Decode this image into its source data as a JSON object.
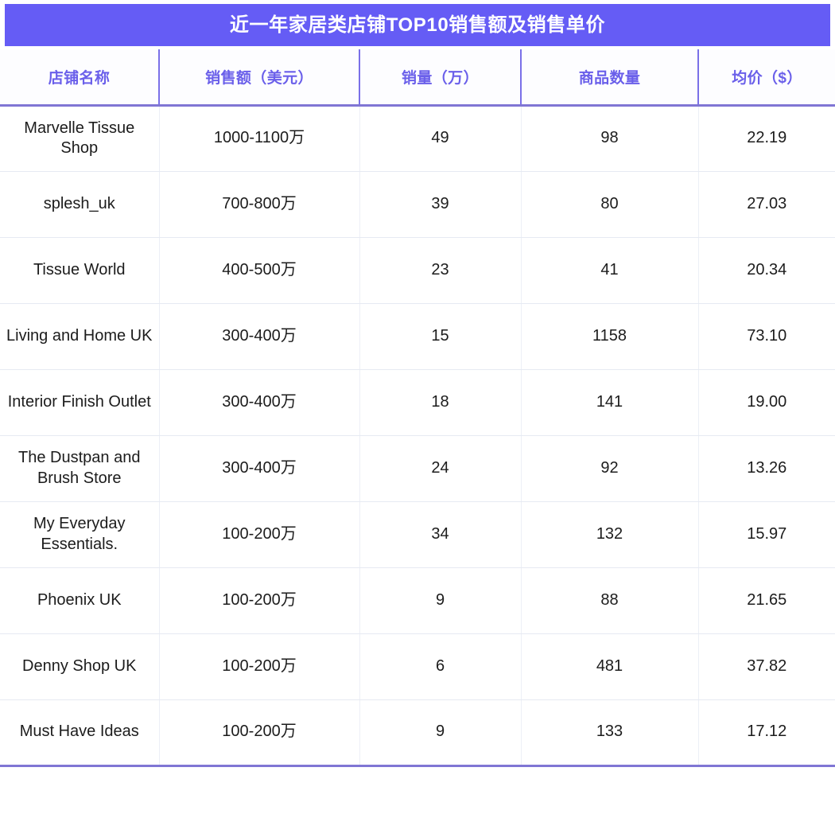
{
  "title": "近一年家居类店铺TOP10销售额及销售单价",
  "theme": {
    "banner_bg": "#655CF5",
    "banner_text": "#FFFFFF",
    "header_text": "#6A5FEA",
    "header_divider": "#7A70E8",
    "body_text": "#1C1C1C",
    "row_divider": "#E6EAF2"
  },
  "chart_data": {
    "type": "table",
    "title": "近一年家居类店铺TOP10销售额及销售单价",
    "columns": [
      "店铺名称",
      "销售额（美元）",
      "销量（万）",
      "商品数量",
      "均价（$）"
    ],
    "rows": [
      [
        "Marvelle Tissue Shop",
        "1000-1100万",
        "49",
        "98",
        "22.19"
      ],
      [
        "splesh_uk",
        "700-800万",
        "39",
        "80",
        "27.03"
      ],
      [
        "Tissue World",
        "400-500万",
        "23",
        "41",
        "20.34"
      ],
      [
        "Living and Home UK",
        "300-400万",
        "15",
        "1158",
        "73.10"
      ],
      [
        "Interior Finish Outlet",
        "300-400万",
        "18",
        "141",
        "19.00"
      ],
      [
        "The Dustpan and Brush Store",
        "300-400万",
        "24",
        "92",
        "13.26"
      ],
      [
        "My Everyday Essentials.",
        "100-200万",
        "34",
        "132",
        "15.97"
      ],
      [
        "Phoenix UK",
        "100-200万",
        "9",
        "88",
        "21.65"
      ],
      [
        "Denny Shop UK",
        "100-200万",
        "6",
        "481",
        "37.82"
      ],
      [
        "Must Have Ideas",
        "100-200万",
        "9",
        "133",
        "17.12"
      ]
    ]
  }
}
